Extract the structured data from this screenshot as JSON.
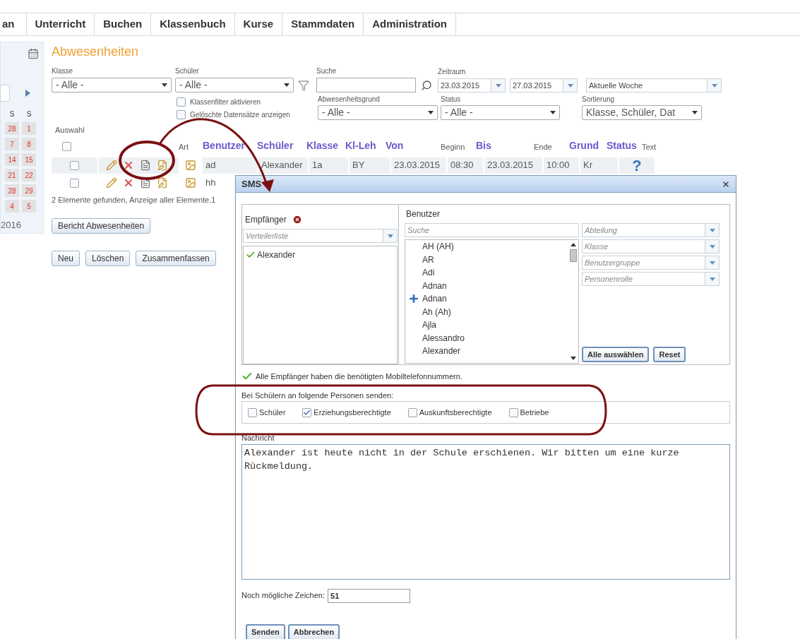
{
  "nav": {
    "tabs": [
      {
        "label": "an"
      },
      {
        "label": "Unterricht"
      },
      {
        "label": "Buchen"
      },
      {
        "label": "Klassenbuch"
      },
      {
        "label": "Kurse"
      },
      {
        "label": "Stammdaten"
      },
      {
        "label": "Administration"
      }
    ]
  },
  "sidebar": {
    "calendar": {
      "weekdays": [
        "S",
        "S"
      ],
      "weeks": [
        [
          "28",
          "1"
        ],
        [
          "7",
          "8"
        ],
        [
          "14",
          "15"
        ],
        [
          "21",
          "22"
        ],
        [
          "28",
          "29"
        ],
        [
          "4",
          "5"
        ]
      ],
      "year": "2016"
    }
  },
  "page": {
    "title": "Abwesenheiten"
  },
  "filters": {
    "klasse": {
      "label": "Klasse",
      "value": "- Alle -"
    },
    "schueler": {
      "label": "Schüler",
      "value": "- Alle -"
    },
    "suche": {
      "label": "Suche"
    },
    "zeitraum": {
      "label": "Zeitraum",
      "from": "23.03.2015",
      "to": "27.03.2015",
      "range": "Aktuelle Woche"
    },
    "checkboxes": [
      {
        "label": "Klassenfilter aktivieren",
        "checked": false
      },
      {
        "label": "Gelöschte Datensätze anzeigen",
        "checked": false
      }
    ],
    "grund": {
      "label": "Abwesenheitsgrund",
      "value": "- Alle -"
    },
    "status": {
      "label": "Status",
      "value": "- Alle -"
    },
    "sortierung": {
      "label": "Sortierung",
      "value": "Klasse, Schüler, Dat"
    }
  },
  "table": {
    "select_label": "Auswahl",
    "select_all_checked": false,
    "art_label": "Art",
    "columns": [
      {
        "label": "Benutzer",
        "kind": "link"
      },
      {
        "label": "Schüler",
        "kind": "link"
      },
      {
        "label": "Klasse",
        "kind": "link"
      },
      {
        "label": "Kl-Leh",
        "kind": "link"
      },
      {
        "label": "Von",
        "kind": "link"
      },
      {
        "label": "Beginn",
        "kind": "plain"
      },
      {
        "label": "Bis",
        "kind": "link"
      },
      {
        "label": "Ende",
        "kind": "plain"
      },
      {
        "label": "Grund",
        "kind": "link"
      },
      {
        "label": "Status",
        "kind": "link"
      },
      {
        "label": "Text",
        "kind": "plain"
      }
    ],
    "rows": [
      {
        "checked": false,
        "cells": [
          "ad",
          "Alexander",
          "1a",
          "BY",
          "23.03.2015",
          "08:30",
          "23.03.2015",
          "10:00",
          "Kr",
          "?"
        ]
      },
      {
        "checked": false,
        "cells": [
          "hh"
        ]
      }
    ],
    "footer": "2 Elemente gefunden, Anzeige aller Elemente.1"
  },
  "report_button": "Bericht Abwesenheiten",
  "buttons": [
    "Neu",
    "Löschen",
    "Zusammenfassen"
  ],
  "dialog": {
    "title": "SMS",
    "recipients": {
      "label": "Empfänger",
      "list_placeholder": "Verteilerliste",
      "items": [
        "Alexander"
      ]
    },
    "users": {
      "label": "Benutzer",
      "search_placeholder": "Suche",
      "items": [
        {
          "name": "AH (AH)",
          "marked": false
        },
        {
          "name": "AR",
          "marked": false
        },
        {
          "name": "Adi",
          "marked": false
        },
        {
          "name": "Adnan",
          "marked": false
        },
        {
          "name": "Adnan",
          "marked": true
        },
        {
          "name": "Ah (Ah)",
          "marked": false
        },
        {
          "name": "Ajla",
          "marked": false
        },
        {
          "name": "Alessandro",
          "marked": false
        },
        {
          "name": "Alexander",
          "marked": false
        }
      ],
      "filters": [
        "Abteilung",
        "Klasse",
        "Benutzergruppe",
        "Personenrolle"
      ],
      "buttons": [
        "Alle auswählen",
        "Reset"
      ]
    },
    "notice": "Alle Empfänger haben die benötigten Mobiltelefonnummern.",
    "send_to": {
      "label": "Bei Schülern an folgende Personen senden:",
      "options": [
        {
          "label": "Schüler",
          "checked": false
        },
        {
          "label": "Erziehungsberechtigte",
          "checked": true
        },
        {
          "label": "Auskunftsberechtigte",
          "checked": false
        },
        {
          "label": "Betriebe",
          "checked": false
        }
      ]
    },
    "message": {
      "label": "Nachricht",
      "value": "Alexander ist heute nicht in der Schule erschienen. Wir bitten um eine kurze Rückmeldung."
    },
    "remaining": {
      "label": "Noch mögliche Zeichen:",
      "value": "51"
    },
    "buttons": [
      "Senden",
      "Abbrechen"
    ]
  }
}
